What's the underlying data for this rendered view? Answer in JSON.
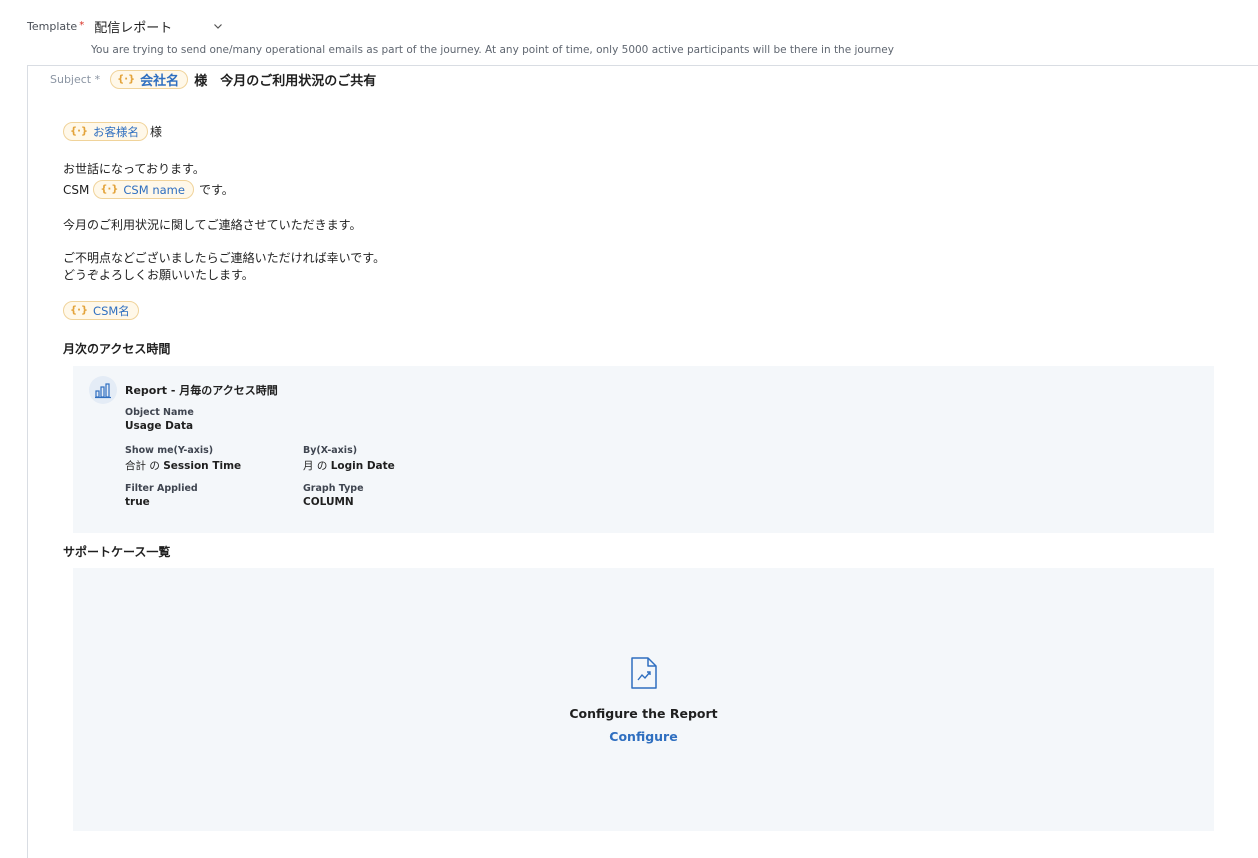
{
  "template": {
    "label": "Template",
    "required_mark": "*",
    "value": "配信レポート",
    "helper": "You are trying to send one/many operational emails as part of the journey. At any point of time, only 5000 active participants will be there in the journey"
  },
  "subject": {
    "label": "Subject *",
    "token": "会社名",
    "text": "様　今月のご利用状況のご共有"
  },
  "body": {
    "greeting_token": "お客様名",
    "greeting_suffix": "様",
    "line1": "お世話になっております。",
    "csm_prefix": "CSM",
    "csm_token": "CSM name",
    "csm_suffix": "です。",
    "line3": "今月のご利用状況に関してご連絡させていただきます。",
    "line4": "ご不明点などございましたらご連絡いただければ幸いです。",
    "line5": "どうぞよろしくお願いいたします。",
    "signature_token": "CSM名"
  },
  "section1": {
    "heading": "月次のアクセス時間",
    "report": {
      "title": "Report - 月毎のアクセス時間",
      "object_name_label": "Object Name",
      "object_name_value": "Usage Data",
      "y_axis_label": "Show me(Y-axis)",
      "y_axis_prefix": "合計 の ",
      "y_axis_value": "Session Time",
      "x_axis_label": "By(X-axis)",
      "x_axis_prefix": "月 の ",
      "x_axis_value": "Login Date",
      "filter_label": "Filter Applied",
      "filter_value": "true",
      "graph_type_label": "Graph Type",
      "graph_type_value": "COLUMN"
    }
  },
  "section2": {
    "heading": "サポートケース一覧",
    "config_title": "Configure the Report",
    "config_link": "Configure"
  },
  "colors": {
    "accent": "#2f6fc0",
    "token_border": "#f0d39a",
    "token_bg": "#fff8e9",
    "card_bg": "#f4f7fa"
  },
  "icons": {
    "token": "variable-icon",
    "chart": "bar-chart-icon",
    "report_file": "report-file-icon",
    "dropdown": "chevron-down-icon"
  }
}
